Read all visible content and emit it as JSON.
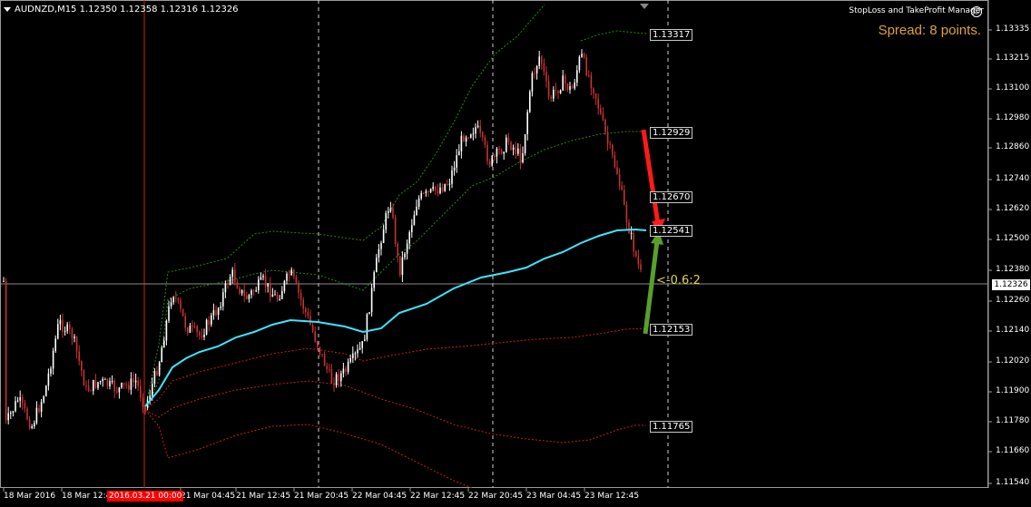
{
  "symbol_header": "AUDNZD,M15  1.12350 1.12358 1.12316 1.12326",
  "manager_title": "StopLoss and TakeProfit Manager",
  "manager_icon": "smiley-icon",
  "spread_text": "Spread: 8 points.",
  "ratio_text": "<-0.6:2",
  "current_price": "1.12326",
  "price_axis": [
    "1.13335",
    "1.13215",
    "1.13100",
    "1.12980",
    "1.12860",
    "1.12740",
    "1.12620",
    "1.12500",
    "1.12380",
    "1.12260",
    "1.12140",
    "1.12020",
    "1.11900",
    "1.11780",
    "1.11660",
    "1.11540"
  ],
  "time_axis": [
    "18 Mar 2016",
    "18 Mar 12:45",
    "21 Mar 04:45",
    "21 Mar 12:45",
    "21 Mar 20:45",
    "22 Mar 04:45",
    "22 Mar 12:45",
    "22 Mar 20:45",
    "23 Mar 04:45",
    "23 Mar 12:45"
  ],
  "time_highlight": "2016.03.21 00:00",
  "levels": {
    "l1": "1.13317",
    "l2": "1.12929",
    "l3": "1.12670",
    "l4": "1.12541",
    "l5": "1.12153",
    "l6": "1.11765"
  },
  "colors": {
    "background": "#000000",
    "bull_candle": "#ffffff",
    "bear_candle": "#c83232",
    "moving_average": "#3ce6ff",
    "upper_bands": "#1e8c1e",
    "lower_bands": "#c81e1e",
    "stop_loss_arrow": "#ff1a1a",
    "take_profit_arrow": "#58a02a",
    "spread_text": "#e0a040"
  }
}
